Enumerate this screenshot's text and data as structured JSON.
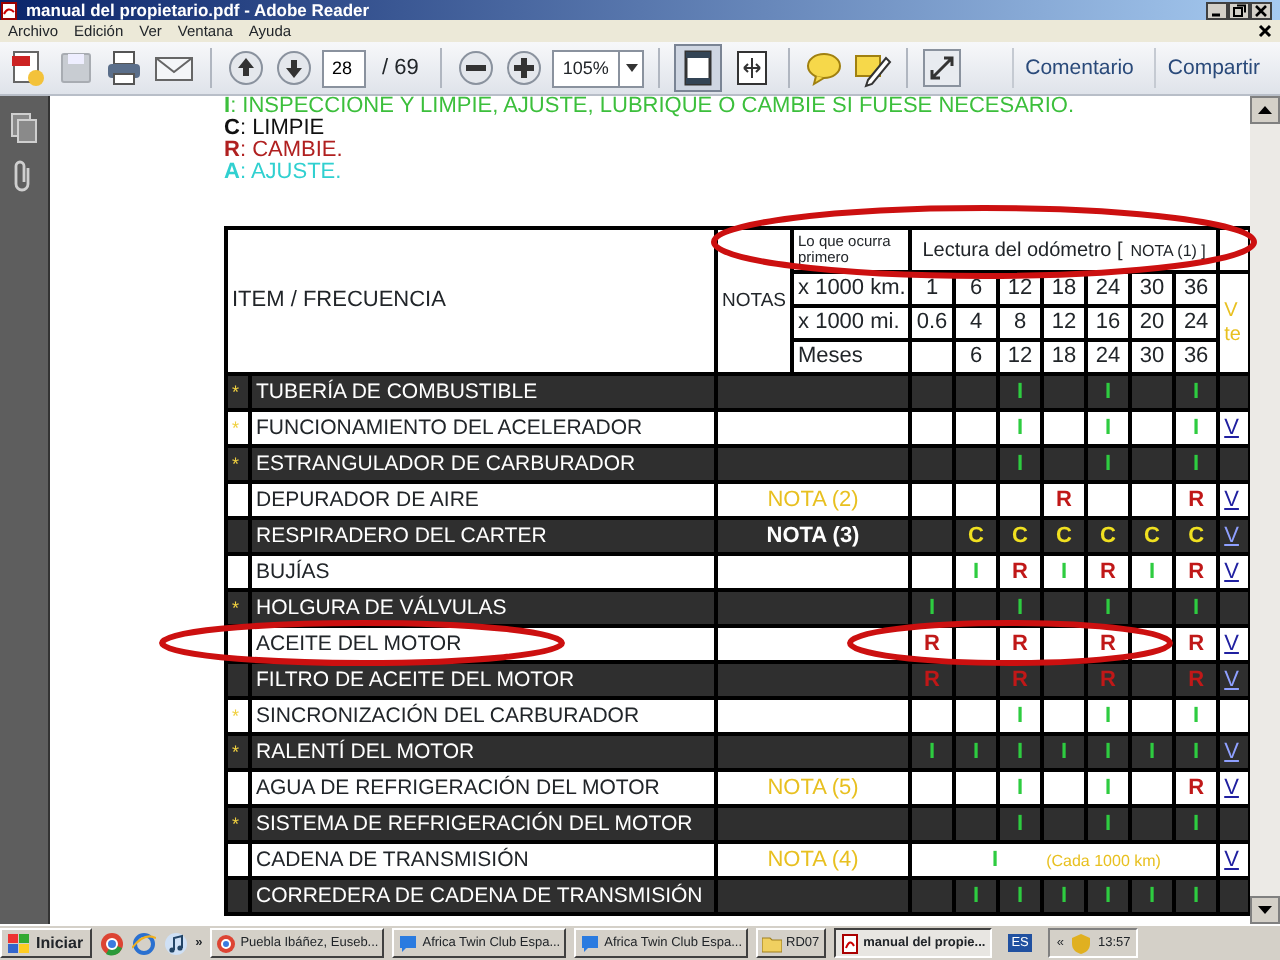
{
  "window": {
    "title": "manual del propietario.pdf - Adobe Reader"
  },
  "menu": [
    "Archivo",
    "Edición",
    "Ver",
    "Ventana",
    "Ayuda"
  ],
  "toolbar": {
    "save_enabled": false,
    "page": "28",
    "page_total": "/ 69",
    "zoom": "105%",
    "view_buttons": [
      {
        "selected": true
      },
      {
        "selected": false
      }
    ],
    "links": [
      "Comentario",
      "Compartir"
    ]
  },
  "legend": [
    {
      "text": "**I**: INSPECCIONE Y LIMPIE, AJUSTE, LUBRIQUE O CAMBIE SI FUESE NECESARIO.",
      "color": "#3cbf3c"
    },
    {
      "text": "**C**: LIMPIE",
      "color": "#111111"
    },
    {
      "text": "**R**: CAMBIE.",
      "color": "#b02020"
    },
    {
      "text": "**A**: AJUSTE.",
      "color": "#30d0d0"
    }
  ],
  "header": {
    "item": "ITEM / FRECUENCIA",
    "notes": "NOTAS",
    "first": "Lo que ocurra primero",
    "odometer": "Lectura del odómetro [",
    "odometer_note": "NOTA (1) ]",
    "side_note": "V te",
    "intervals": [
      {
        "label": "x 1000 km.",
        "values": [
          "1",
          "6",
          "12",
          "18",
          "24",
          "30",
          "36"
        ]
      },
      {
        "label": "x 1000 mi.",
        "values": [
          "0.6",
          "4",
          "8",
          "12",
          "16",
          "20",
          "24"
        ]
      },
      {
        "label": "Meses",
        "first_blank": true,
        "values": [
          "6",
          "12",
          "18",
          "24",
          "30",
          "36"
        ]
      }
    ]
  },
  "rows": [
    {
      "kind": "schedule",
      "shaded": true,
      "marker": "*",
      "item": "TUBERÍA DE COMBUSTIBLE",
      "cells": [
        null,
        null,
        {
          "text": "I",
          "kind": "inspect"
        },
        null,
        {
          "text": "I",
          "kind": "inspect"
        },
        null,
        {
          "text": "I",
          "kind": "inspect"
        }
      ]
    },
    {
      "kind": "schedule",
      "shaded": false,
      "marker": "*",
      "item": "FUNCIONAMIENTO DEL ACELERADOR",
      "cells": [
        null,
        null,
        {
          "text": "I",
          "kind": "inspect"
        },
        null,
        {
          "text": "I",
          "kind": "inspect"
        },
        null,
        {
          "text": "I",
          "kind": "inspect"
        }
      ],
      "link": "V"
    },
    {
      "kind": "schedule",
      "shaded": true,
      "marker": "*",
      "item": "ESTRANGULADOR DE CARBURADOR",
      "cells": [
        null,
        null,
        {
          "text": "I",
          "kind": "inspect"
        },
        null,
        {
          "text": "I",
          "kind": "inspect"
        },
        null,
        {
          "text": "I",
          "kind": "inspect"
        }
      ]
    },
    {
      "kind": "schedule",
      "shaded": false,
      "item": "DEPURADOR DE AIRE",
      "note": "NOTA (2)",
      "cells": [
        null,
        null,
        null,
        {
          "text": "R",
          "kind": "replace"
        },
        null,
        null,
        {
          "text": "R",
          "kind": "replace"
        }
      ],
      "link": "V"
    },
    {
      "kind": "schedule",
      "shaded": true,
      "item": "RESPIRADERO DEL CARTER",
      "note": "NOTA (3)",
      "cells": [
        null,
        {
          "text": "C",
          "kind": "clean"
        },
        {
          "text": "C",
          "kind": "clean"
        },
        {
          "text": "C",
          "kind": "clean"
        },
        {
          "text": "C",
          "kind": "clean"
        },
        {
          "text": "C",
          "kind": "clean"
        },
        {
          "text": "C",
          "kind": "clean"
        }
      ],
      "link": "V"
    },
    {
      "kind": "schedule",
      "shaded": false,
      "item": "BUJÍAS",
      "cells": [
        null,
        {
          "text": "I",
          "kind": "inspect"
        },
        {
          "text": "R",
          "kind": "replace"
        },
        {
          "text": "I",
          "kind": "inspect"
        },
        {
          "text": "R",
          "kind": "replace"
        },
        {
          "text": "I",
          "kind": "inspect"
        },
        {
          "text": "R",
          "kind": "replace"
        }
      ],
      "link": "V"
    },
    {
      "kind": "schedule",
      "shaded": true,
      "marker": "*",
      "item": "HOLGURA DE VÁLVULAS",
      "cells": [
        {
          "text": "I",
          "kind": "inspect"
        },
        null,
        {
          "text": "I",
          "kind": "inspect"
        },
        null,
        {
          "text": "I",
          "kind": "inspect"
        },
        null,
        {
          "text": "I",
          "kind": "inspect"
        }
      ]
    },
    {
      "kind": "schedule",
      "shaded": false,
      "item": "ACEITE DEL MOTOR",
      "cells": [
        {
          "text": "R",
          "kind": "replace"
        },
        null,
        {
          "text": "R",
          "kind": "replace"
        },
        null,
        {
          "text": "R",
          "kind": "replace"
        },
        null,
        {
          "text": "R",
          "kind": "replace"
        }
      ],
      "link": "V"
    },
    {
      "kind": "schedule",
      "shaded": true,
      "item": "FILTRO DE ACEITE DEL MOTOR",
      "cells": [
        {
          "text": "R",
          "kind": "replace"
        },
        null,
        {
          "text": "R",
          "kind": "replace"
        },
        null,
        {
          "text": "R",
          "kind": "replace"
        },
        null,
        {
          "text": "R",
          "kind": "replace"
        }
      ],
      "link": "V"
    },
    {
      "kind": "schedule",
      "shaded": false,
      "marker": "*",
      "item": "SINCRONIZACIÓN DEL CARBURADOR",
      "cells": [
        null,
        null,
        {
          "text": "I",
          "kind": "inspect"
        },
        null,
        {
          "text": "I",
          "kind": "inspect"
        },
        null,
        {
          "text": "I",
          "kind": "inspect"
        }
      ]
    },
    {
      "kind": "schedule",
      "shaded": true,
      "marker": "*",
      "item": "RALENTÍ DEL MOTOR",
      "cells": [
        {
          "text": "I",
          "kind": "inspect"
        },
        {
          "text": "I",
          "kind": "inspect"
        },
        {
          "text": "I",
          "kind": "inspect"
        },
        {
          "text": "I",
          "kind": "inspect"
        },
        {
          "text": "I",
          "kind": "inspect"
        },
        {
          "text": "I",
          "kind": "inspect"
        },
        {
          "text": "I",
          "kind": "inspect"
        }
      ],
      "link": "V"
    },
    {
      "kind": "schedule",
      "shaded": false,
      "item": "AGUA DE REFRIGERACIÓN DEL MOTOR",
      "note": "NOTA (5)",
      "cells": [
        null,
        null,
        {
          "text": "I",
          "kind": "inspect"
        },
        null,
        {
          "text": "I",
          "kind": "inspect"
        },
        null,
        {
          "text": "R",
          "kind": "replace"
        }
      ],
      "link": "V"
    },
    {
      "kind": "schedule",
      "shaded": true,
      "marker": "*",
      "item": "SISTEMA DE REFRIGERACIÓN DEL MOTOR",
      "cells": [
        null,
        null,
        {
          "text": "I",
          "kind": "inspect"
        },
        null,
        {
          "text": "I",
          "kind": "inspect"
        },
        null,
        {
          "text": "I",
          "kind": "inspect"
        }
      ]
    },
    {
      "kind": "interval",
      "shaded": false,
      "item": "CADENA DE TRANSMISIÓN",
      "note": "NOTA (4)",
      "mark": {
        "text": "I",
        "kind": "inspect"
      },
      "interval": "(Cada 1000 km)",
      "link": "V"
    },
    {
      "kind": "schedule",
      "shaded": true,
      "item": "CORREDERA DE CADENA DE TRANSMISIÓN",
      "cells": [
        null,
        {
          "text": "I",
          "kind": "inspect"
        },
        {
          "text": "I",
          "kind": "inspect"
        },
        {
          "text": "I",
          "kind": "inspect"
        },
        {
          "text": "I",
          "kind": "inspect"
        },
        {
          "text": "I",
          "kind": "inspect"
        },
        {
          "text": "I",
          "kind": "inspect"
        }
      ]
    }
  ],
  "annotations": [
    {
      "kind": "ellipse"
    },
    {
      "kind": "ellipse"
    },
    {
      "kind": "ellipse"
    }
  ],
  "taskbar": {
    "start": "Iniciar",
    "overflow": "»",
    "tasks": [
      {
        "label": "Puebla Ibáñez, Euseb...",
        "kind": "browser",
        "selected": false
      },
      {
        "label": "Africa Twin Club Espa...",
        "kind": "chat",
        "selected": false
      },
      {
        "label": "Africa Twin Club Espa...",
        "kind": "chat",
        "selected": false
      },
      {
        "label": "RD07",
        "kind": "folder",
        "selected": false
      },
      {
        "label": "manual del propie...",
        "kind": "pdf",
        "selected": true
      }
    ],
    "language": "ES",
    "tray_toggle": "«",
    "clock": "13:57"
  }
}
